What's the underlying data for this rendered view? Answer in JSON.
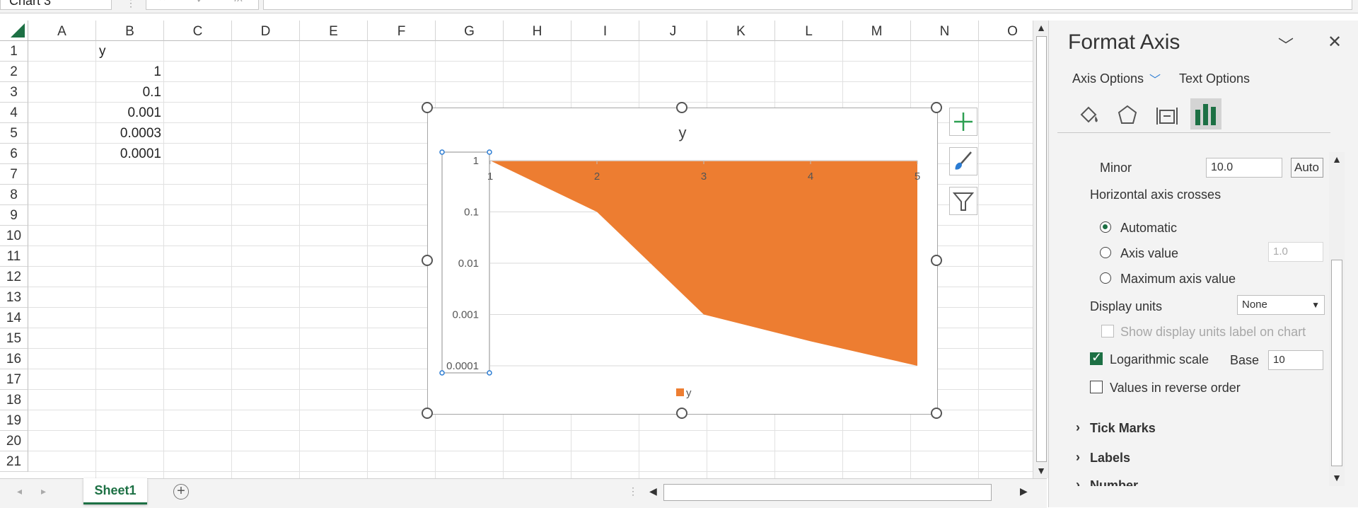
{
  "formula_bar": {
    "name_box": "Chart 3",
    "cancel_icon": "×",
    "enter_icon": "✓",
    "fx_label": "fx",
    "formula": ""
  },
  "columns": [
    "A",
    "B",
    "C",
    "D",
    "E",
    "F",
    "G",
    "H",
    "I",
    "J",
    "K",
    "L",
    "M",
    "N",
    "O"
  ],
  "rows": [
    "1",
    "2",
    "3",
    "4",
    "5",
    "6",
    "7",
    "8",
    "9",
    "10",
    "11",
    "12",
    "13",
    "14",
    "15",
    "16",
    "17",
    "18",
    "19",
    "20",
    "21"
  ],
  "cells": {
    "B1": "y",
    "B2": "1",
    "B3": "0.1",
    "B4": "0.001",
    "B5": "0.0003",
    "B6": "0.0001"
  },
  "sheet_tabs": [
    {
      "label": "Sheet1",
      "active": true
    }
  ],
  "add_sheet": "+",
  "chart_data": {
    "type": "area",
    "title": "y",
    "x": [
      1,
      2,
      3,
      4,
      5
    ],
    "series": [
      {
        "name": "y",
        "values": [
          1,
          0.1,
          0.001,
          0.0003,
          0.0001
        ],
        "color": "#ED7D31"
      }
    ],
    "x_tick_labels": [
      "1",
      "2",
      "3",
      "4",
      "5"
    ],
    "y_tick_labels": [
      "1",
      "0.1",
      "0.01",
      "0.001",
      "0.0001"
    ],
    "y_scale": "log",
    "ylim": [
      0.0001,
      1
    ],
    "grid": true,
    "legend": "bottom"
  },
  "chart_tools": [
    "add-element-icon",
    "brush-icon",
    "filter-icon"
  ],
  "pane": {
    "title": "Format Axis",
    "tab_axis_options": "Axis Options",
    "tab_text_options": "Text Options",
    "icons": [
      "fill-line-icon",
      "effects-icon",
      "size-properties-icon",
      "axis-options-icon"
    ],
    "minor_label": "Minor",
    "minor_value": "10.0",
    "auto_button": "Auto",
    "crosses_heading": "Horizontal axis crosses",
    "radio_automatic": "Automatic",
    "radio_axis_value": "Axis value",
    "axis_value": "1.0",
    "radio_maximum": "Maximum axis value",
    "display_units_label": "Display units",
    "display_units_value": "None",
    "show_units_label": "Show display units label on chart",
    "log_scale_label": "Logarithmic scale",
    "base_label": "Base",
    "base_value": "10",
    "reverse_label": "Values in reverse order",
    "section_tick_marks": "Tick Marks",
    "section_labels": "Labels",
    "section_number": "Number"
  },
  "colors": {
    "accent": "#1d7044",
    "series": "#ED7D31",
    "link_blue": "#2b7cd3"
  }
}
